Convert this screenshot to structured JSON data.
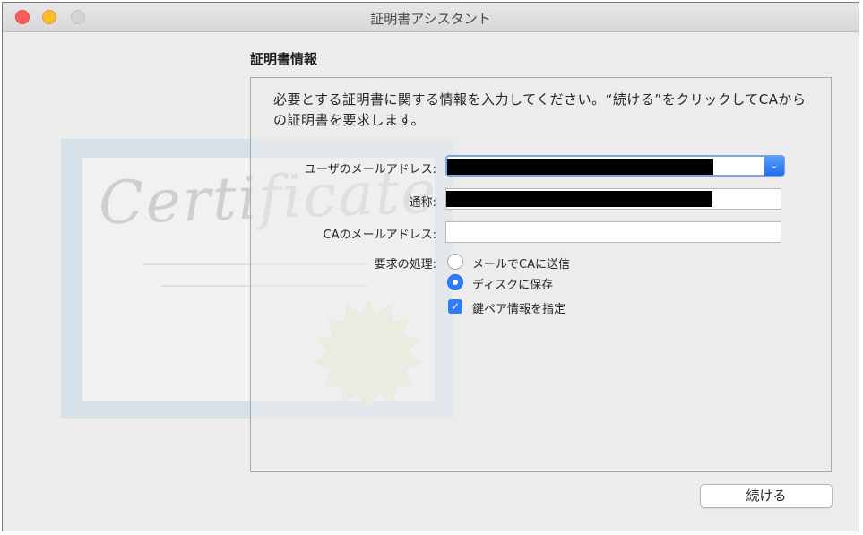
{
  "window": {
    "title": "証明書アシスタント"
  },
  "artwork": {
    "script_text": "Certificate"
  },
  "section": {
    "heading": "証明書情報",
    "description": "必要とする証明書に関する情報を入力してください。“続ける”をクリックしてCAからの証明書を要求します。"
  },
  "form": {
    "email_label": "ユーザのメールアドレス:",
    "email_value": "",
    "name_label": "通称:",
    "name_value": "",
    "ca_email_label": "CAのメールアドレス:",
    "ca_email_value": "",
    "request_label": "要求の処理:",
    "options": [
      {
        "label": "メールでCAに送信",
        "selected": false
      },
      {
        "label": "ディスクに保存",
        "selected": true
      }
    ],
    "keypair_label": "鍵ペア情報を指定",
    "keypair_checked": true
  },
  "buttons": {
    "continue_label": "続ける"
  },
  "colors": {
    "accent": "#2f7cf6",
    "close": "#fc5f57",
    "minimize": "#fdbc2e",
    "zoom": "#d5d3d5"
  }
}
